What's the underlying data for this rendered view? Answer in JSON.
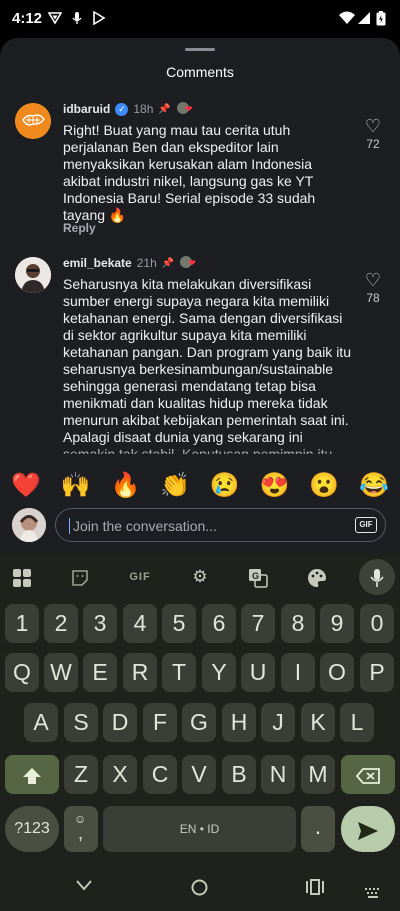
{
  "status_bar": {
    "time": "4:12"
  },
  "sheet": {
    "title": "Comments"
  },
  "comments": [
    {
      "username": "idbaruid",
      "time": "18h",
      "text": "Right! Buat yang mau tau cerita utuh perjalanan Ben dan ekspeditor lain menyaksikan kerusakan alam Indonesia akibat industri nikel, langsung gas ke YT Indonesia Baru! Serial episode 33 sudah tayang 🔥",
      "reply_label": "Reply",
      "likes": "72",
      "verified": true
    },
    {
      "username": "emil_bekate",
      "time": "21h",
      "text": "Seharusnya kita melakukan diversifikasi sumber energi supaya negara kita memiliki ketahanan energi. Sama dengan diversifikasi di sektor agrikultur supaya kita memiliki ketahanan pangan. Dan program yang baik itu seharusnya berkesinambungan/sustainable sehingga generasi mendatang tetap bisa menikmati dan kualitas hidup mereka tidak menurun akibat kebijakan pemerintah saat ini. Apalagi disaat dunia yang sekarang ini semakin tak stabil. Keputusan pemimpin itu",
      "likes": "78",
      "verified": false
    }
  ],
  "emoji_bar": [
    "❤️",
    "🙌",
    "🔥",
    "👏",
    "😢",
    "😍",
    "😮",
    "😂"
  ],
  "composer": {
    "placeholder": "Join the conversation...",
    "gif_label": "GIF"
  },
  "keyboard": {
    "toolbar_gif": "GIF",
    "row_numbers": [
      "1",
      "2",
      "3",
      "4",
      "5",
      "6",
      "7",
      "8",
      "9",
      "0"
    ],
    "row_q": [
      "Q",
      "W",
      "E",
      "R",
      "T",
      "Y",
      "U",
      "I",
      "O",
      "P"
    ],
    "row_a": [
      "A",
      "S",
      "D",
      "F",
      "G",
      "H",
      "J",
      "K",
      "L"
    ],
    "row_z": [
      "Z",
      "X",
      "C",
      "V",
      "B",
      "N",
      "M"
    ],
    "symbols_key": "?123",
    "space_label": "EN • ID",
    "period_key": ".",
    "comma_emoji_key": ","
  },
  "colors": {
    "sheet_bg": "#1c1e22",
    "keyboard_bg": "#1f221c",
    "key_bg": "#3b3e37",
    "accent_key": "#566645",
    "enter_key": "#b7ccab",
    "verified_blue": "#3d8bff"
  }
}
